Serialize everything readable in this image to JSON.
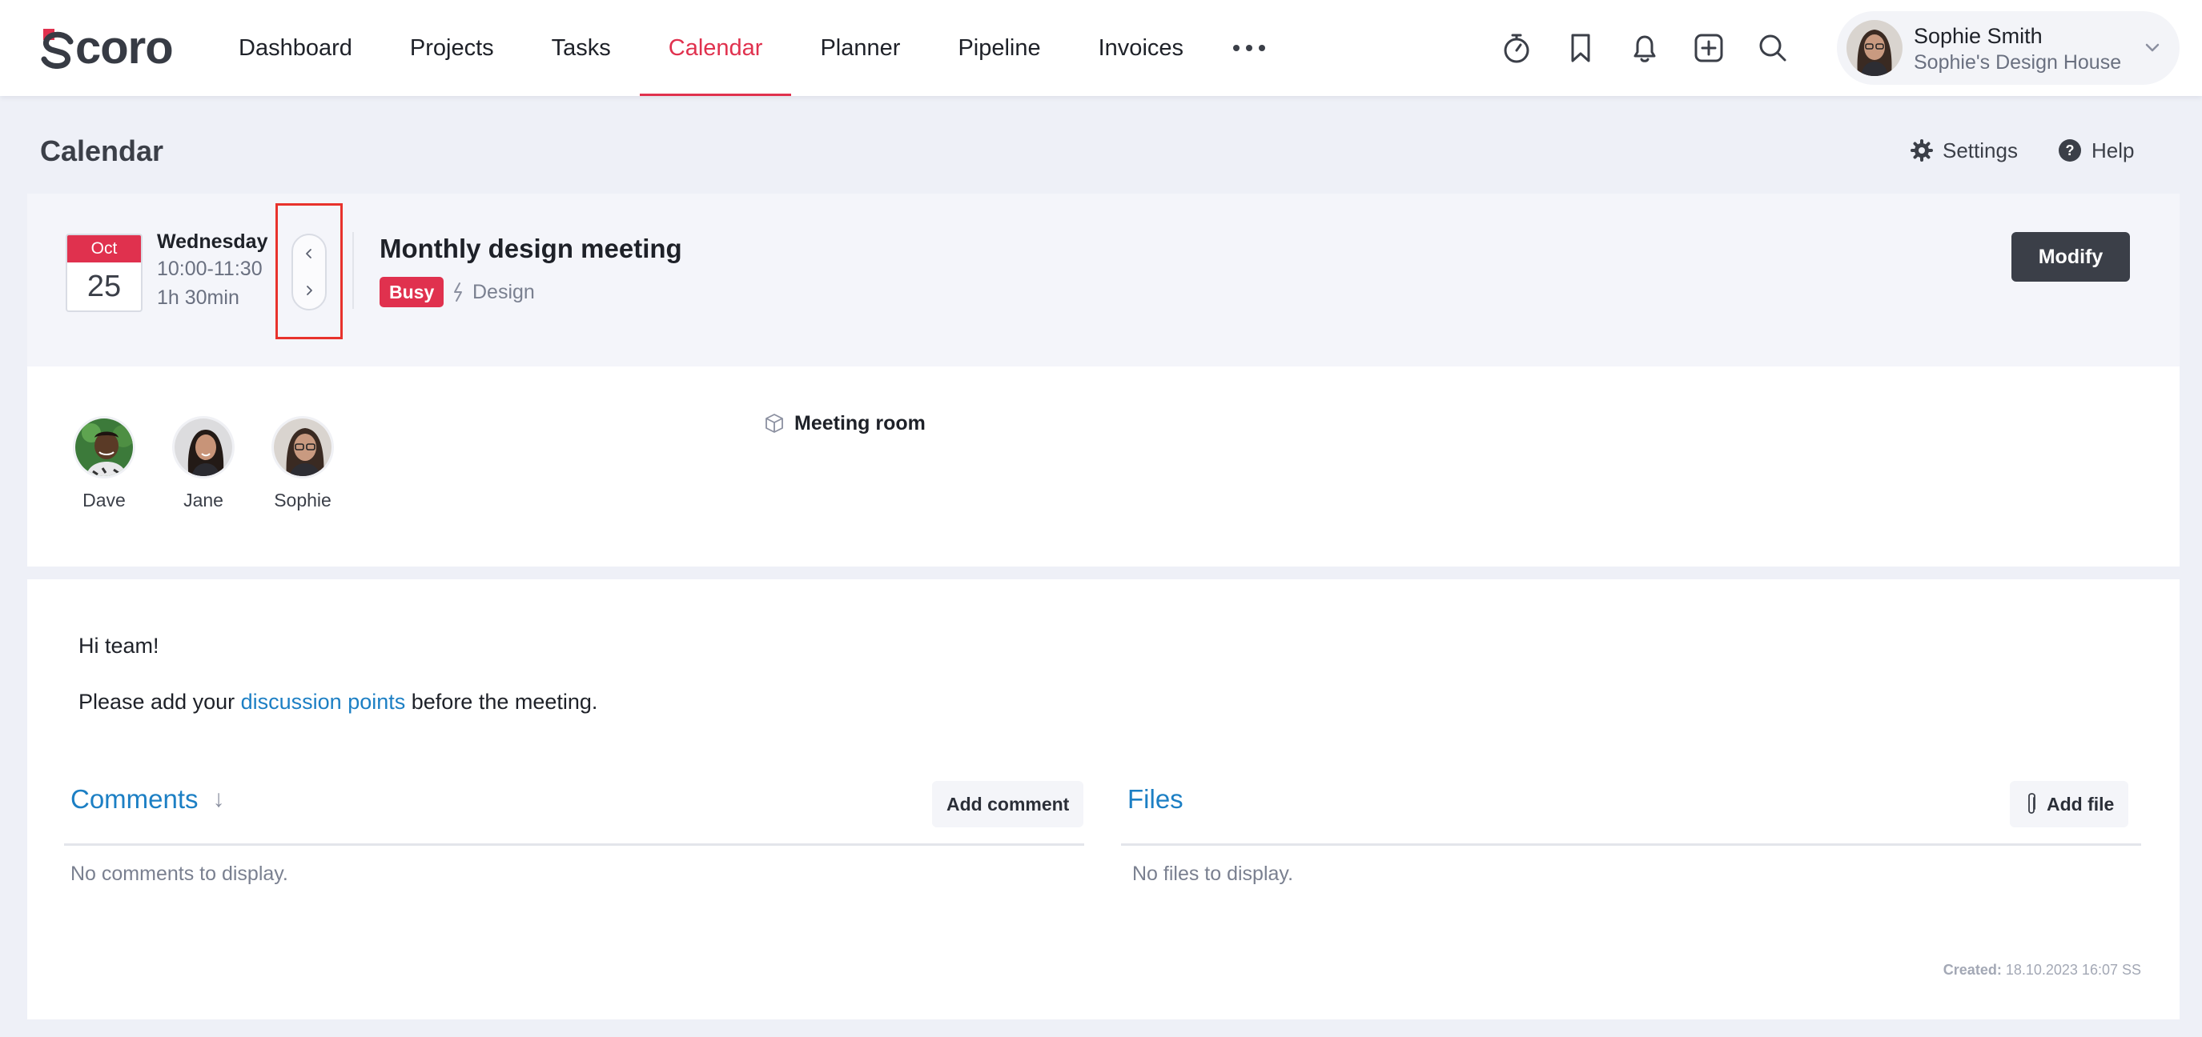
{
  "app": {
    "logo_text": "Scoro"
  },
  "nav": {
    "items": [
      {
        "label": "Dashboard"
      },
      {
        "label": "Projects"
      },
      {
        "label": "Tasks"
      },
      {
        "label": "Calendar",
        "active": true
      },
      {
        "label": "Planner"
      },
      {
        "label": "Pipeline"
      },
      {
        "label": "Invoices"
      }
    ],
    "more_icon": "more-horizontal-icon"
  },
  "toolbar_icons": [
    "timer-icon",
    "bookmark-icon",
    "bell-icon",
    "add-square-icon",
    "search-icon"
  ],
  "user": {
    "name": "Sophie Smith",
    "company": "Sophie's Design House"
  },
  "page": {
    "title": "Calendar",
    "settings_label": "Settings",
    "help_label": "Help"
  },
  "event": {
    "month": "Oct",
    "day": "25",
    "weekday": "Wednesday",
    "time": "10:00-11:30",
    "duration": "1h 30min",
    "title": "Monthly design meeting",
    "status": "Busy",
    "category": "Design",
    "modify_label": "Modify"
  },
  "participants": [
    {
      "name": "Dave"
    },
    {
      "name": "Jane"
    },
    {
      "name": "Sophie"
    }
  ],
  "resource": {
    "label": "Meeting room"
  },
  "description": {
    "line1": "Hi team!",
    "line2_before": "Please add your ",
    "line2_link": "discussion points",
    "line2_after": " before the meeting."
  },
  "comments": {
    "title": "Comments",
    "sort_arrow": "↓",
    "add_label": "Add comment",
    "empty": "No comments to display."
  },
  "files": {
    "title": "Files",
    "add_label": "Add file",
    "empty": "No files to display."
  },
  "created": {
    "label": "Created:",
    "value": "18.10.2023 16:07 SS"
  },
  "colors": {
    "accent": "#e0314e",
    "link": "#1c7fc4",
    "dark_button": "#3b3f48",
    "highlight_frame": "#e8322c"
  }
}
